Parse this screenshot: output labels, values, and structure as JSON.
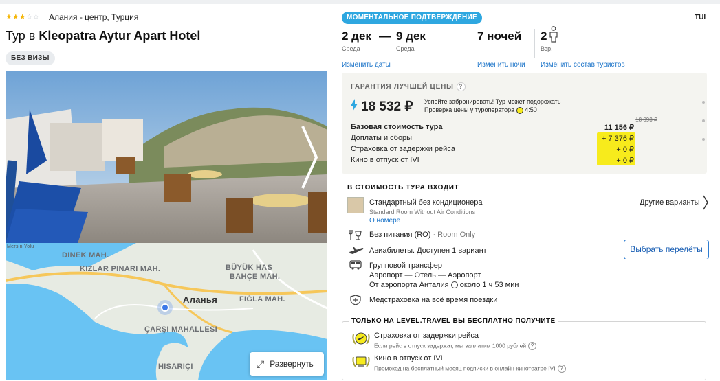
{
  "hotel": {
    "stars_on": "★★★",
    "stars_off": "☆☆",
    "location": "Алания - центр, Турция",
    "title_prefix": "Тур в ",
    "title_name": "Kleopatra Aytur Apart Hotel",
    "visa_badge": "БЕЗ ВИЗЫ"
  },
  "map": {
    "labels": {
      "dinek": "DINEK MAH.",
      "kizlar": "KIZLAR PINARI MAH.",
      "buyuk": "BÜYÜK HAS",
      "bahce": "BAHÇE MAH.",
      "city": "Аланья",
      "figla": "FIĞLA MAH.",
      "carsi": "ÇARŞI MAHALLESI",
      "hisarici": "HISARIÇI",
      "mersin": "Mersin Yolu"
    },
    "expand_label": "Развернуть"
  },
  "booking": {
    "confirm_badge": "МОМЕНТАЛЬНОЕ ПОДТВЕРЖДЕНИЕ",
    "operator": "TUI",
    "date_from": "2 дек",
    "dash": "—",
    "date_to": "9 дек",
    "day_from": "Среда",
    "day_to": "Среда",
    "nights": "7 ночей",
    "tourists_count": "2",
    "tourists_label": "Взр.",
    "change_dates": "Изменить даты",
    "change_nights": "Изменить ночи",
    "change_tourists": "Изменить состав туристов"
  },
  "price": {
    "guarantee": "ГАРАНТИЯ ЛУЧШЕЙ ЦЕНЫ",
    "q": "?",
    "total": "18 532 ₽",
    "note_line1": "Успейте забронировать! Тур может подорожать",
    "note_line2": "Проверка цены у туроператора",
    "timer": "4:50",
    "old_price": "18 093 ₽",
    "rows": [
      {
        "label": "Базовая стоимость тура",
        "value": "11 156 ₽"
      },
      {
        "label": "Доплаты и сборы",
        "value": "+ 7 376 ₽"
      },
      {
        "label": "Страховка от задержки рейса",
        "value": "+ 0 ₽"
      },
      {
        "label": "Кино в отпуск от IVI",
        "value": "+ 0 ₽"
      }
    ]
  },
  "included": {
    "heading": "В СТОИМОСТЬ ТУРА ВХОДИТ",
    "room_name": "Стандартный без кондиционера",
    "room_en": "Standard Room Without Air Conditions",
    "room_link": "О номере",
    "other_variants": "Другие варианты",
    "meal": "Без питания (RO)",
    "meal_en": " · Room Only",
    "flights": "Авиабилеты. Доступен 1 вариант",
    "choose_flights": "Выбрать перелёты",
    "transfer": "Групповой трансфер",
    "transfer_route": "Аэропорт — Отель — Аэропорт",
    "transfer_from": "От аэропорта Анталия",
    "transfer_time": "около 1 ч 53 мин",
    "insurance": "Медстраховка на всё время поездки"
  },
  "promo": {
    "title": "ТОЛЬКО НА LEVEL.TRAVEL ВЫ БЕСПЛАТНО ПОЛУЧИТЕ",
    "item1_title": "Страховка от задержки рейса",
    "item1_sub": "Если рейс в отпуск задержат, мы заплатим 1000 рублей",
    "item2_title": "Кино в отпуск от IVI",
    "item2_sub": "Промокод на бесплатный месяц подписки в онлайн-кинотеатре IVI"
  },
  "colors": {
    "accent_blue": "#2ea7e0",
    "link_blue": "#1a73c8",
    "highlight_yellow": "#f7eb1c"
  }
}
